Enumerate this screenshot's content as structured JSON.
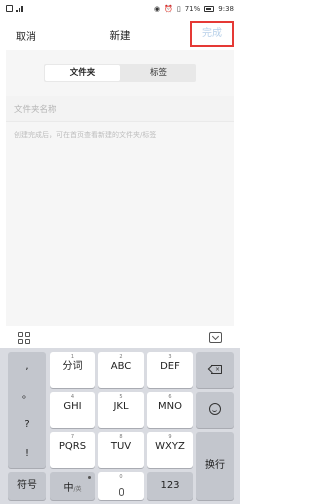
{
  "status_bar": {
    "battery": "71%",
    "time": "9:38"
  },
  "header": {
    "cancel": "取消",
    "title": "新建",
    "done": "完成"
  },
  "segment": {
    "tabs": [
      "文件夹",
      "标签"
    ]
  },
  "form": {
    "name_placeholder": "文件夹名称",
    "hint": "创建完成后，可在首页查看新建的文件夹/标签"
  },
  "keyboard": {
    "side_keys": [
      ",",
      "。",
      "?",
      "!"
    ],
    "rows": [
      [
        {
          "num": "1",
          "label": "分词"
        },
        {
          "num": "2",
          "label": "ABC"
        },
        {
          "num": "3",
          "label": "DEF"
        }
      ],
      [
        {
          "num": "4",
          "label": "GHI"
        },
        {
          "num": "5",
          "label": "JKL"
        },
        {
          "num": "6",
          "label": "MNO"
        }
      ],
      [
        {
          "num": "7",
          "label": "PQRS"
        },
        {
          "num": "8",
          "label": "TUV"
        },
        {
          "num": "9",
          "label": "WXYZ"
        }
      ]
    ],
    "symbol": "符号",
    "chinese": "中",
    "chinese_sub": "/英",
    "space_num": "0",
    "num_key": "123",
    "enter": "换行"
  }
}
